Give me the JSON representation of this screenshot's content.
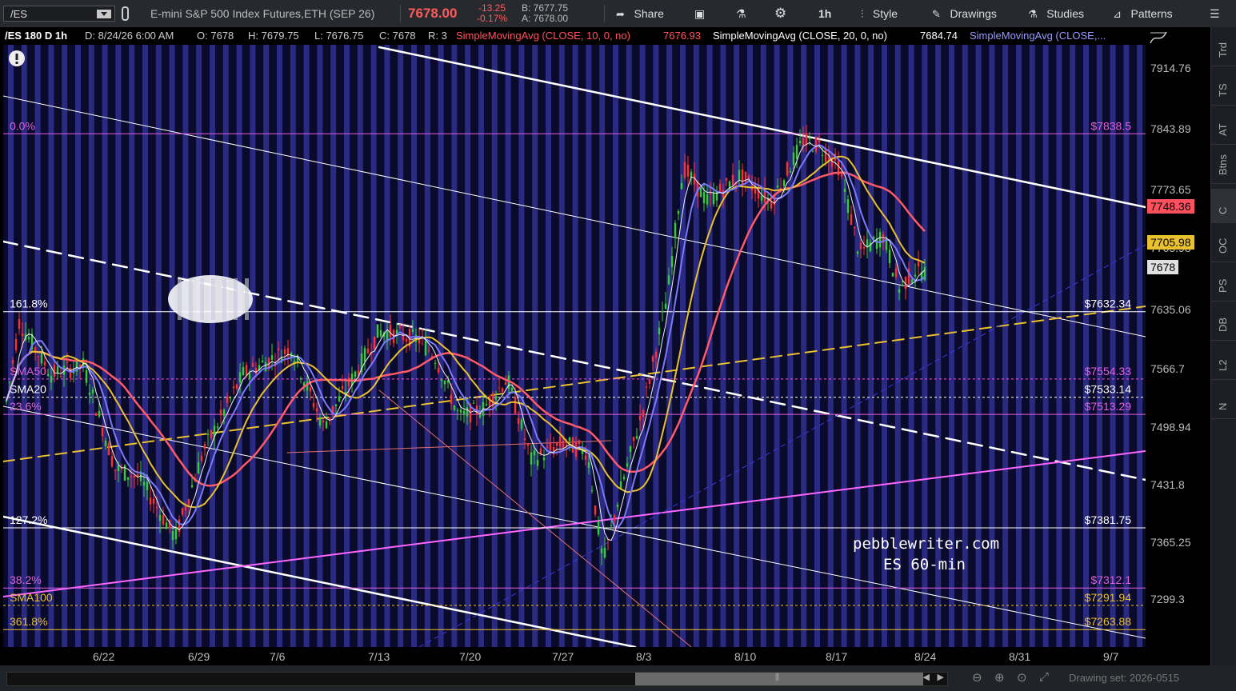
{
  "toolbar": {
    "symbol": "/ES",
    "description": "E-mini S&P 500 Index Futures,ETH (SEP 26)",
    "last": "7678.00",
    "net_change": "-13.25",
    "pct_change": "-0.17%",
    "bid": "B: 7677.75",
    "ask": "A: 7678.00",
    "share": "Share",
    "timeframe": "1h",
    "style": "Style",
    "drawings": "Drawings",
    "studies": "Studies",
    "patterns": "Patterns"
  },
  "header": {
    "chart_id": "/ES 180 D 1h",
    "date": "D: 8/24/26 6:00 AM",
    "open": "O: 7678",
    "high": "H: 7679.75",
    "low": "L: 7676.75",
    "close": "C: 7678",
    "range": "R: 3",
    "sma10": "SimpleMovingAvg (CLOSE, 10, 0, no)",
    "sma10_val": "7676.93",
    "sma20": "SimpleMovingAvg (CLOSE, 20, 0, no)",
    "sma20_val": "7684.74",
    "sma50": "SimpleMovingAvg (CLOSE,..."
  },
  "price_axis": [
    "7914.76",
    "7843.89",
    "7773.65",
    "7705.98",
    "7635.06",
    "7566.7",
    "7498.94",
    "7431.8",
    "7365.25",
    "7299.3"
  ],
  "price_tags": {
    "red": "7748.36",
    "gold": "7705.98",
    "last": "7678"
  },
  "levels": [
    {
      "left": "0.0%",
      "right": "$7838.5",
      "color": "#e060e0"
    },
    {
      "left": "161.8%",
      "right": "$7632.34",
      "color": "#ffffff"
    },
    {
      "left": "SMA50",
      "right": "$7554.33",
      "color": "#e060e0"
    },
    {
      "left": "SMA20",
      "right": "$7533.14",
      "color": "#ffffff"
    },
    {
      "left": "23.6%",
      "right": "$7513.29",
      "color": "#e060e0"
    },
    {
      "left": "127.2%",
      "right": "$7381.75",
      "color": "#ffffff"
    },
    {
      "left": "38.2%",
      "right": "$7312.1",
      "color": "#e060e0"
    },
    {
      "left": "SMA100",
      "right": "$7291.94",
      "color": "#e8c030"
    },
    {
      "left": "361.8%",
      "right": "$7263.88",
      "color": "#e8c030"
    }
  ],
  "dates": [
    "6/22",
    "6/29",
    "7/6",
    "7/13",
    "7/20",
    "7/27",
    "8/3",
    "8/10",
    "8/17",
    "8/24",
    "8/31",
    "9/7"
  ],
  "watermark": [
    "pebblewriter.com",
    "ES 60-min"
  ],
  "sidebar": [
    "Trd",
    "TS",
    "AT",
    "Btns",
    "C",
    "OC",
    "PS",
    "DB",
    "L2",
    "N"
  ],
  "drawing_set": "Drawing set: 2026-0515"
}
